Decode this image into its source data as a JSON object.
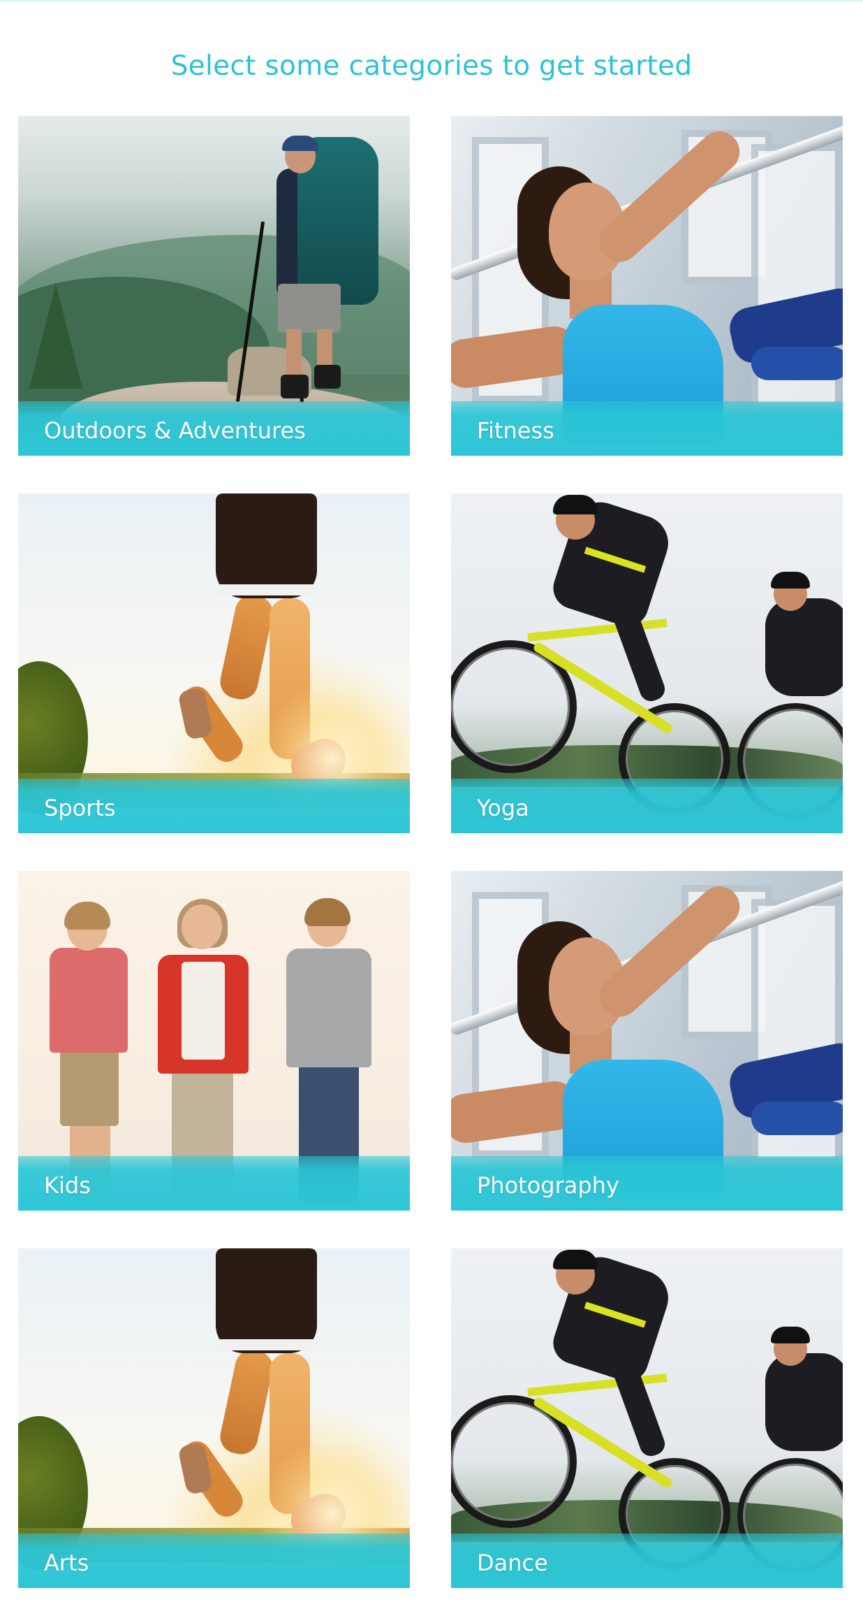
{
  "header": {
    "title": "Select some categories to get started"
  },
  "categories": [
    {
      "label": "Outdoors  & Adventures",
      "image": "hiker-with-backpack"
    },
    {
      "label": "Fitness",
      "image": "woman-gym-pulldown"
    },
    {
      "label": "Sports",
      "image": "runner-legs-sunlight"
    },
    {
      "label": "Yoga",
      "image": "road-cyclists"
    },
    {
      "label": "Kids",
      "image": "three-children"
    },
    {
      "label": "Photography",
      "image": "woman-gym-pulldown"
    },
    {
      "label": "Arts",
      "image": "runner-legs-sunlight"
    },
    {
      "label": "Dance",
      "image": "road-cyclists"
    }
  ],
  "colors": {
    "accent": "#2bc3d5",
    "overlay": "#2ec6d7",
    "label_text": "#ffffff",
    "background": "#ffffff"
  }
}
